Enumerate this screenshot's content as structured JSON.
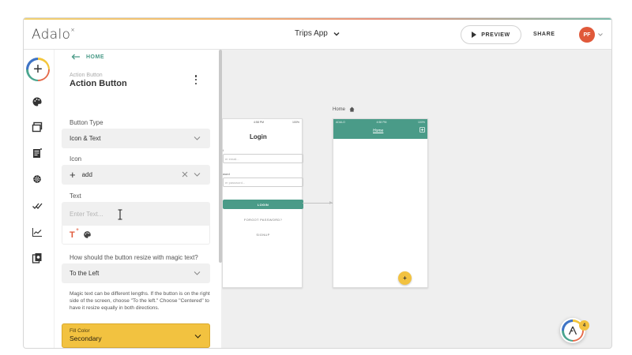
{
  "header": {
    "logo": "Adalo",
    "app_title": "Trips App",
    "preview_label": "PREVIEW",
    "share_label": "SHARE",
    "avatar_initials": "PF"
  },
  "rail": {
    "icons": [
      "add-icon",
      "palette-icon",
      "screens-icon",
      "components-icon",
      "settings-icon",
      "publish-icon",
      "analytics-icon",
      "clone-icon"
    ]
  },
  "panel": {
    "back_label": "HOME",
    "subtitle": "Action Button",
    "title": "Action Button",
    "button_type_label": "Button Type",
    "button_type_value": "Icon & Text",
    "icon_label": "Icon",
    "icon_value": "add",
    "text_label": "Text",
    "text_placeholder": "Enter Text...",
    "resize_label": "How should the button resize with magic text?",
    "resize_value": "To the Left",
    "help_text": "Magic text can be different lengths. If the button is on the right side of the screen, choose \"To the left.\" Choose \"Centered\" to have it resize equally in both directions.",
    "fill_color_label": "Fill Color",
    "fill_color_value": "Secondary"
  },
  "canvas": {
    "login_screen": {
      "title": "Login",
      "email_label": "l",
      "email_placeholder": "er email...",
      "password_label": "word",
      "password_placeholder": "er password...",
      "login_button": "LOGIN",
      "forgot_link": "FORGOT PASSWORD?",
      "signup_link": "SIGNUP",
      "status_time": "4:58 PM",
      "status_battery": "100%"
    },
    "home_screen": {
      "label": "Home",
      "title": "Home",
      "status_carrier": "ADALO",
      "status_time": "4:58 PM",
      "status_battery": "100%",
      "fab_label": "+"
    }
  },
  "help_badge": {
    "count": "4"
  },
  "colors": {
    "accent": "#4a9b88",
    "fill_secondary": "#f2c240",
    "avatar": "#e0593a"
  }
}
